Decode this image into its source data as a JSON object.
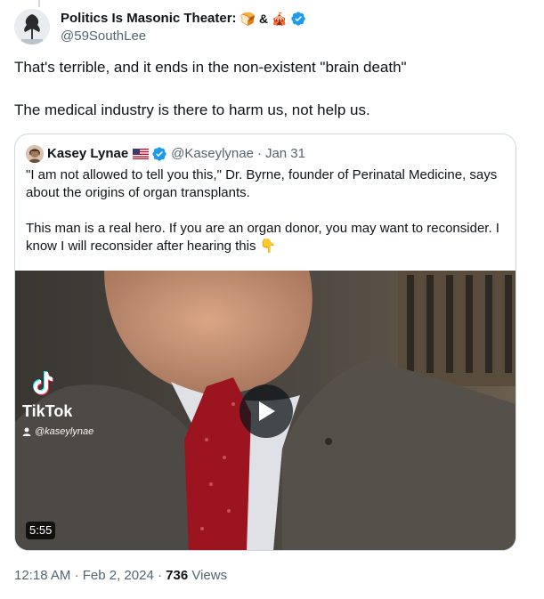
{
  "author": {
    "name": "Politics Is Masonic Theater:",
    "name_emoji_1": "🍞",
    "name_amp": "&",
    "name_emoji_2": "🎪",
    "handle": "@59SouthLee",
    "verified": true
  },
  "tweet": {
    "paragraph_1": "That's terrible, and it ends in the non-existent \"brain death\"",
    "paragraph_2": "The medical industry is there to harm us, not help us."
  },
  "quoted_tweet": {
    "name": "Kasey Lynae",
    "verified": true,
    "handle": "@Kaseylynae",
    "separator": "·",
    "date": "Jan 31",
    "paragraph_1": "\"I am not allowed to tell you this,\" Dr. Byrne, founder of Perinatal Medicine, says about the origins of organ transplants.",
    "paragraph_2": "This man is a real hero. If you are an organ donor, you may want to reconsider. I know I will reconsider after hearing this 👇",
    "video": {
      "watermark_brand": "TikTok",
      "watermark_user": "@kaseylynae",
      "duration": "5:55"
    }
  },
  "meta": {
    "time": "12:18 AM",
    "separator": "·",
    "date": "Feb 2, 2024",
    "views_count": "736",
    "views_label": "Views"
  },
  "colors": {
    "verified_blue": "#1d9bf0",
    "secondary_text": "#536471",
    "border": "#cfd9de"
  }
}
